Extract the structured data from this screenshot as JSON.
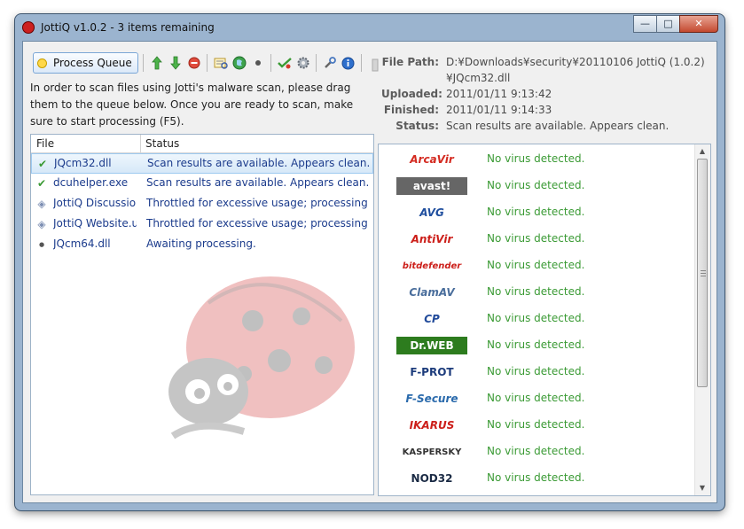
{
  "window": {
    "title": "JottiQ v1.0.2 - 3 items remaining",
    "controls": {
      "minimize": "—",
      "maximize": "□",
      "close": "✕"
    }
  },
  "toolbar": {
    "process_queue_label": "Process Queue",
    "icons": [
      "bulb-icon",
      "move-up-icon",
      "move-down-icon",
      "remove-icon",
      "open-log-icon",
      "browse-web-icon",
      "bullet-icon",
      "check-all-icon",
      "settings-icon",
      "tools-icon",
      "info-icon",
      "grip-icon"
    ]
  },
  "instructions": "In order to scan files using Jotti's malware scan, please drag them to the queue below. Once you are ready to scan, make sure to start processing (F5).",
  "file_list": {
    "columns": [
      "File",
      "Status"
    ],
    "rows": [
      {
        "icon": "check-icon",
        "file": "JQcm32.dll",
        "status": "Scan results are available. Appears clean.",
        "selected": true
      },
      {
        "icon": "check-icon",
        "file": "dcuhelper.exe",
        "status": "Scan results are available. Appears clean.",
        "selected": false
      },
      {
        "icon": "tag-icon",
        "file": "JottiQ Discussio",
        "status": "Throttled for excessive usage; processing",
        "selected": false
      },
      {
        "icon": "tag-icon",
        "file": "JottiQ Website.u",
        "status": "Throttled for excessive usage; processing",
        "selected": false
      },
      {
        "icon": "dot-icon",
        "file": "JQcm64.dll",
        "status": "Awaiting processing.",
        "selected": false
      }
    ]
  },
  "details": {
    "file_path_label": "File Path:",
    "file_path_value": "D:¥Downloads¥security¥20110106 JottiQ (1.0.2)",
    "file_path_value_2": "¥JQcm32.dll",
    "uploaded_label": "Uploaded:",
    "uploaded_value": "2011/01/11 9:13:42",
    "finished_label": "Finished:",
    "finished_value": "2011/01/11 9:14:33",
    "status_label": "Status:",
    "status_value": "Scan results are available. Appears clean."
  },
  "scanners": [
    {
      "name": "ArcaVir",
      "result": "No virus detected.",
      "color": "#d42a20"
    },
    {
      "name": "avast!",
      "result": "No virus detected.",
      "color": "#555555"
    },
    {
      "name": "AVG",
      "result": "No virus detected.",
      "color": "#1f4e9e"
    },
    {
      "name": "AntiVir",
      "result": "No virus detected.",
      "color": "#cc1f1a"
    },
    {
      "name": "bitdefender",
      "result": "No virus detected.",
      "color": "#cc1f1a"
    },
    {
      "name": "ClamAV",
      "result": "No virus detected.",
      "color": "#4a6e9c"
    },
    {
      "name": "CP",
      "result": "No virus detected.",
      "color": "#214a9a"
    },
    {
      "name": "Dr.WEB",
      "result": "No virus detected.",
      "color": "#2d7c1e"
    },
    {
      "name": "F-PROT",
      "result": "No virus detected.",
      "color": "#1d3c7c"
    },
    {
      "name": "F-Secure",
      "result": "No virus detected.",
      "color": "#2a6aac"
    },
    {
      "name": "IKARUS",
      "result": "No virus detected.",
      "color": "#cc1f1a"
    },
    {
      "name": "KASPERSKY",
      "result": "No virus detected.",
      "color": "#333333"
    },
    {
      "name": "NOD32",
      "result": "No virus detected.",
      "color": "#1a2a44"
    }
  ],
  "colors": {
    "clean_text": "#3a9a34",
    "link_text": "#1b3b8c",
    "selection": "#d6e8f8"
  }
}
